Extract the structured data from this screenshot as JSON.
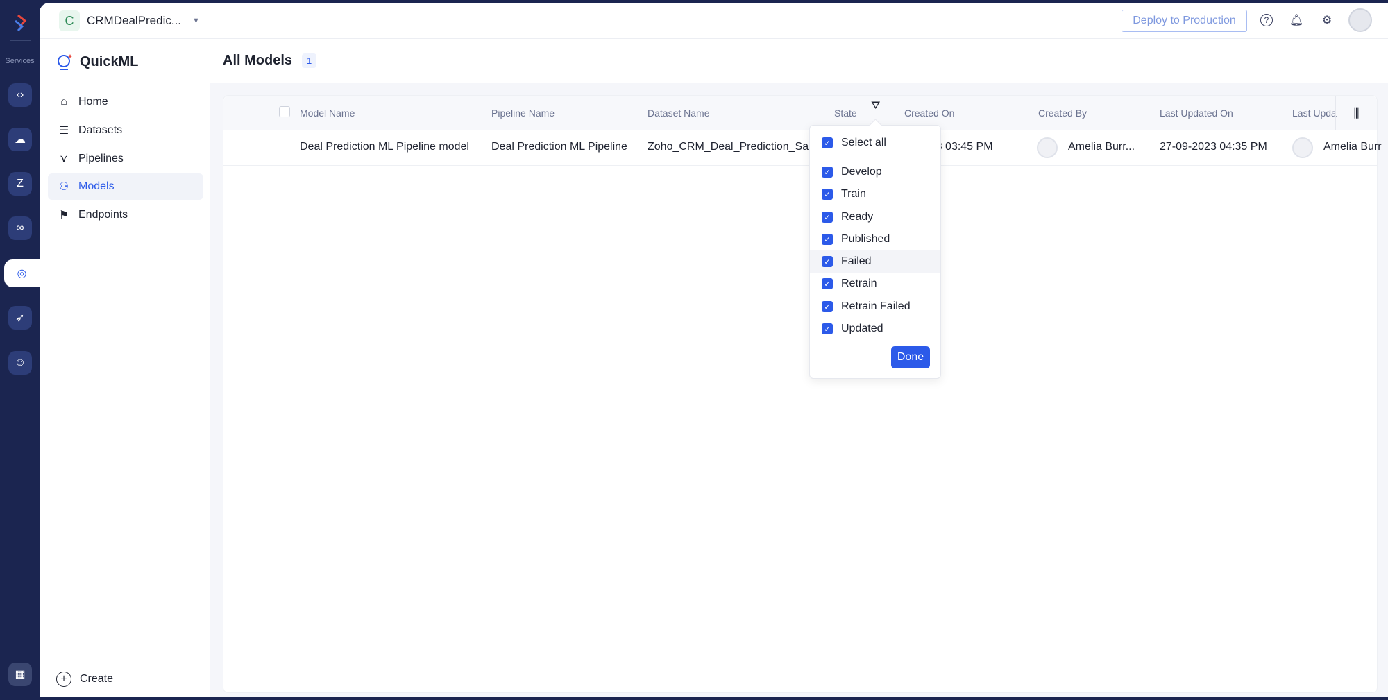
{
  "rail": {
    "services_label": "Services",
    "icons": [
      "code-brackets-icon",
      "cloud-analytics-icon",
      "zia-icon",
      "infinity-icon",
      "quickml-icon",
      "rocket-icon",
      "chatbot-icon"
    ],
    "bottom_icon": "apps-grid-icon"
  },
  "header": {
    "project_initial": "C",
    "project_name": "CRMDealPredic...",
    "deploy_label": "Deploy to Production"
  },
  "sidebar": {
    "brand": "QuickML",
    "items": [
      {
        "label": "Home",
        "icon": "⌂"
      },
      {
        "label": "Datasets",
        "icon": "☰"
      },
      {
        "label": "Pipelines",
        "icon": "⋎"
      },
      {
        "label": "Models",
        "icon": "⚇"
      },
      {
        "label": "Endpoints",
        "icon": "⚑"
      }
    ],
    "active": "Models",
    "create_label": "Create"
  },
  "main": {
    "title": "All Models",
    "count": "1",
    "columns": [
      "Model Name",
      "Pipeline Name",
      "Dataset Name",
      "State",
      "Created On",
      "Created By",
      "Last Updated On",
      "Last Upda"
    ],
    "rows": [
      {
        "model": "Deal Prediction ML Pipeline model",
        "pipeline": "Deal Prediction ML Pipeline",
        "dataset": "Zoho_CRM_Deal_Prediction_Sa...",
        "created_on": "2023 03:45 PM",
        "created_by": "Amelia Burr...",
        "last_updated_on": "27-09-2023 04:35 PM",
        "last_updated_by": "Amelia Burr"
      }
    ]
  },
  "state_filter": {
    "select_all": "Select all",
    "options": [
      "Develop",
      "Train",
      "Ready",
      "Published",
      "Failed",
      "Retrain",
      "Retrain Failed",
      "Updated"
    ],
    "checked": [
      true,
      true,
      true,
      true,
      true,
      true,
      true,
      true
    ],
    "highlighted": "Failed",
    "done_label": "Done"
  },
  "colors": {
    "accent": "#2c5ae9",
    "rail": "#1b2550"
  }
}
